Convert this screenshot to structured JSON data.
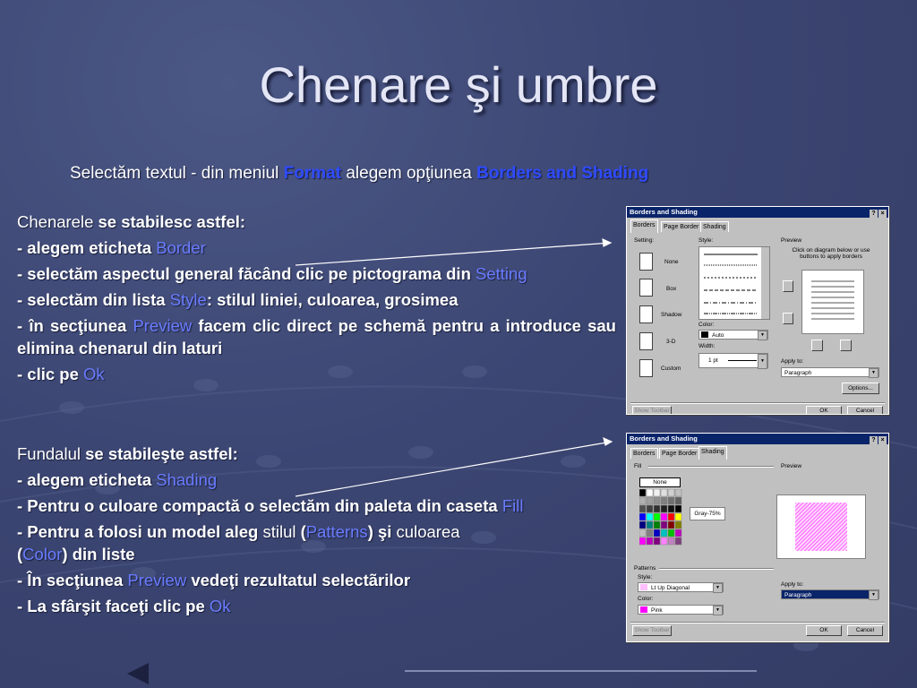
{
  "slide": {
    "title": "Chenare şi umbre",
    "subtitle": {
      "t1": "Selectăm textul -  din meniul ",
      "format": "Format",
      "t2": " alegem opţiunea ",
      "borders": "Borders and Shading"
    }
  },
  "block1": {
    "l1a": "Chenarele",
    "l1b": " se stabilesc astfel:",
    "l2a": "- alegem eticheta ",
    "l2b": "Border",
    "l3a": "- selectăm aspectul general făcând clic pe pictograma din ",
    "l3b": "Setting",
    "l4a": "- selectăm din lista ",
    "l4b": "Style",
    "l4c": ": stilul liniei, culoarea, grosimea",
    "l5a": "- în secţiunea ",
    "l5b": "Preview",
    "l5c": " facem clic direct pe schemă pentru a introduce sau elimina chenarul din laturi",
    "l6a": "-  clic pe ",
    "l6b": "Ok"
  },
  "block2": {
    "l1a": "Fundalul",
    "l1b": " se stabileşte astfel:",
    "l2a": "- alegem eticheta ",
    "l2b": "Shading",
    "l3a": "- Pentru o culoare compactă o selectăm din paleta din caseta ",
    "l3b": "Fill",
    "l4a": "- Pentru a folosi un model aleg ",
    "l4b": "stilul",
    "l4c": " (",
    "l4d": "Patterns",
    "l4e": ") şi",
    "l4f": " culoarea",
    "l4g": "(",
    "l4h": "Color",
    "l4i": ") din liste",
    "l5a": "- În secţiunea ",
    "l5b": "Preview",
    "l5c": " vedeţi rezultatul selectãrilor",
    "l6a": "- La sfârşit faceţi clic pe ",
    "l6b": "Ok"
  },
  "dialog1": {
    "title": "Borders and Shading",
    "help": "?",
    "close": "×",
    "tabs": [
      "Borders",
      "Page Border",
      "Shading"
    ],
    "setting_label": "Setting:",
    "settings": [
      "None",
      "Box",
      "Shadow",
      "3-D",
      "Custom"
    ],
    "style_label": "Style:",
    "color_label": "Color:",
    "color_value": "Auto",
    "width_label": "Width:",
    "width_value": "1 pt",
    "preview_label": "Preview",
    "preview_hint": "Click on diagram below or use buttons to apply borders",
    "apply_label": "Apply to:",
    "apply_value": "Paragraph",
    "options": "Options...",
    "show_toolbar": "Show Toolbar",
    "ok": "OK",
    "cancel": "Cancel"
  },
  "dialog2": {
    "title": "Borders and Shading",
    "help": "?",
    "close": "×",
    "tabs": [
      "Borders",
      "Page Border",
      "Shading"
    ],
    "fill_label": "Fill",
    "none": "None",
    "gray_value": "Gray-75%",
    "patterns_label": "Patterns",
    "style_label": "Style:",
    "style_value": "Lt Up Diagonal",
    "color_label": "Color:",
    "color_value": "Pink",
    "preview_label": "Preview",
    "apply_label": "Apply to:",
    "apply_value": "Paragraph",
    "show_toolbar": "Show Toolbar",
    "ok": "OK",
    "cancel": "Cancel"
  },
  "colors": {
    "accent": "#2f4bff",
    "link": "#6a7cff",
    "bg": "#3c4673",
    "pink": "#ff66ff"
  }
}
